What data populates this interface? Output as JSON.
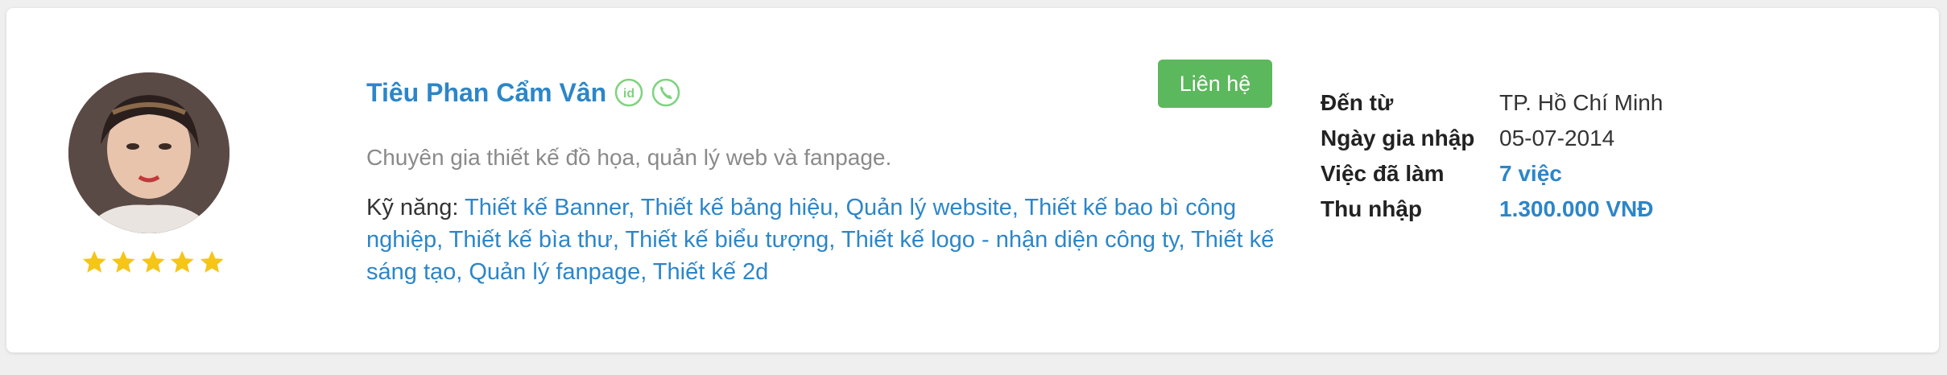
{
  "profile": {
    "name": "Tiêu Phan Cẩm Vân",
    "rating": 5,
    "contact_label": "Liên hệ",
    "description": "Chuyên gia thiết kế đồ họa, quản lý web và fanpage.",
    "skills_label": "Kỹ năng:",
    "skills_text": "Thiết kế Banner, Thiết kế bảng hiệu, Quản lý website, Thiết kế bao bì công nghiệp, Thiết kế bìa thư, Thiết kế biểu tượng, Thiết kế logo - nhận diện công ty, Thiết kế sáng tạo, Quản lý fanpage, Thiết kế 2d"
  },
  "info": {
    "from_label": "Đến từ",
    "from_value": "TP. Hồ Chí Minh",
    "joined_label": "Ngày gia nhập",
    "joined_value": "05-07-2014",
    "jobs_label": "Việc đã làm",
    "jobs_value": "7 việc",
    "income_label": "Thu nhập",
    "income_value": "1.300.000 VNĐ"
  },
  "colors": {
    "accent": "#2c86c8",
    "button": "#5cb85c",
    "star": "#f5c518",
    "verified": "#7ed37e"
  },
  "icons": {
    "id_badge": "id-verified-icon",
    "phone_badge": "phone-verified-icon",
    "star": "star-icon"
  }
}
